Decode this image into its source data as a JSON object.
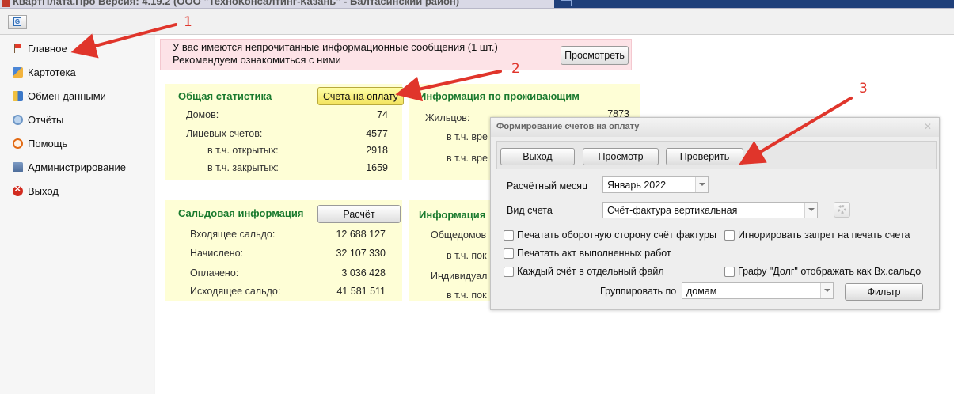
{
  "window": {
    "title": "КвартПлата.Про Версия: 4.19.2 (ООО \"ТехноКонсалтинг-Казань\" - Балтасинский район)"
  },
  "sidebar": {
    "items": [
      {
        "label": "Главное",
        "icon": "flag-icon"
      },
      {
        "label": "Картотека",
        "icon": "cards-icon"
      },
      {
        "label": "Обмен данными",
        "icon": "exchange-icon"
      },
      {
        "label": "Отчёты",
        "icon": "reports-icon"
      },
      {
        "label": "Помощь",
        "icon": "help-icon"
      },
      {
        "label": "Администрирование",
        "icon": "admin-icon"
      },
      {
        "label": "Выход",
        "icon": "exit-icon"
      }
    ]
  },
  "notice": {
    "line1": "У вас имеются непрочитанные информационные сообщения (1 шт.)",
    "line2": "Рекомендуем ознакомиться с ними",
    "button": "Просмотреть"
  },
  "general_stats": {
    "title": "Общая статистика",
    "button": "Счета на оплату",
    "rows": [
      {
        "label": "Домов:",
        "value": "74"
      },
      {
        "label": "Лицевых счетов:",
        "value": "4577"
      },
      {
        "label": "в т.ч. открытых:",
        "value": "2918"
      },
      {
        "label": "в т.ч. закрытых:",
        "value": "1659"
      }
    ]
  },
  "residents": {
    "title": "Информация по проживающим",
    "rows": [
      {
        "label": "Жильцов:",
        "value": "7873"
      },
      {
        "label": "в т.ч. вре"
      },
      {
        "label": "в т.ч. вре"
      }
    ]
  },
  "balance": {
    "title": "Сальдовая информация",
    "button": "Расчёт",
    "rows": [
      {
        "label": "Входящее сальдо:",
        "value": "12 688 127"
      },
      {
        "label": "Начислено:",
        "value": "32 107 330"
      },
      {
        "label": "Оплачено:",
        "value": "3 036 428"
      },
      {
        "label": "Исходящее сальдо:",
        "value": "41 581 511"
      }
    ]
  },
  "info2": {
    "title": "Информация",
    "rows": [
      {
        "label": "Общедомов"
      },
      {
        "label": "в т.ч. пок"
      },
      {
        "label": "Индивидуал"
      },
      {
        "label": "в т.ч. пок"
      }
    ]
  },
  "dialog": {
    "title": "Формирование счетов на оплату",
    "buttons": {
      "exit": "Выход",
      "preview": "Просмотр",
      "check": "Проверить",
      "filter": "Фильтр"
    },
    "month_label": "Расчётный месяц",
    "month_value": "Январь 2022",
    "type_label": "Вид счета",
    "type_value": "Счёт-фактура вертикальная",
    "group_label": "Группировать по",
    "group_value": "домам",
    "checkboxes": {
      "back_side": "Печатать оборотную сторону счёт фактуры",
      "ignore_ban": "Игнорировать запрет на печать счета",
      "act": "Печатать акт выполненных работ",
      "separate_file": "Каждый счёт в отдельный файл",
      "debt_as_in": "Графу \"Долг\" отображать как Вх.сальдо"
    }
  },
  "annotations": {
    "n1": "1",
    "n2": "2",
    "n3": "3"
  },
  "colors": {
    "arrow": "#e0352b",
    "panel": "#fefed6",
    "title_green": "#1a7a2e",
    "notice_bg": "#fde3e7"
  }
}
